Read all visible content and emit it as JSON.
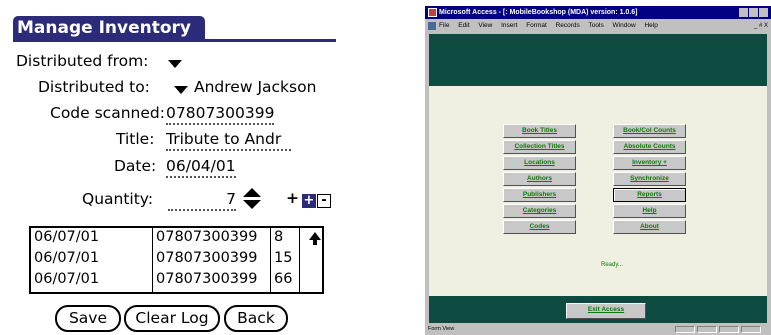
{
  "palm": {
    "title": "Manage Inventory",
    "distributed_from_label": "Distributed from:",
    "distributed_from_value": "",
    "distributed_to_label": "Distributed to:",
    "distributed_to_value": "Andrew Jackson",
    "code_label": "Code scanned:",
    "code_value": "07807300399",
    "title_label": "Title:",
    "title_value": "Tribute to Andr",
    "date_label": "Date:",
    "date_value": "06/04/01",
    "quantity_label": "Quantity:",
    "quantity_value": "7",
    "plus": "+",
    "plus_box": "+",
    "minus_box": "-",
    "log": [
      {
        "date": "06/07/01",
        "code": "07807300399",
        "qty": "8"
      },
      {
        "date": "06/07/01",
        "code": "07807300399",
        "qty": "15"
      },
      {
        "date": "06/07/01",
        "code": "07807300399",
        "qty": "66"
      }
    ],
    "buttons": {
      "save": "Save",
      "clear_log": "Clear Log",
      "back": "Back"
    }
  },
  "access": {
    "window_title": "Microsoft Access - [: MobileBookshop (MDA)    version: 1.0.6]",
    "menu": [
      "File",
      "Edit",
      "View",
      "Insert",
      "Format",
      "Records",
      "Tools",
      "Window",
      "Help"
    ],
    "menu_right": "_ # X",
    "left_buttons": [
      "Book Titles",
      "Collection Titles",
      "Locations",
      "Authors",
      "Publishers",
      "Categories",
      "Codes"
    ],
    "right_buttons": [
      "Book/Col Counts",
      "Absolute Counts",
      "Inventory +",
      "Synchronize",
      "Reports",
      "Help",
      "About"
    ],
    "selected_right_index": 4,
    "status_message": "Ready...",
    "exit_button": "Exit Access",
    "statusbar": "Form View",
    "colors": {
      "palm_title_bg": "#2b2b7a",
      "access_dark_green": "#0d4a40",
      "access_body": "#f0f0e2",
      "button_text_green": "#0a7a0a",
      "titlebar_blue": "#000080"
    }
  }
}
